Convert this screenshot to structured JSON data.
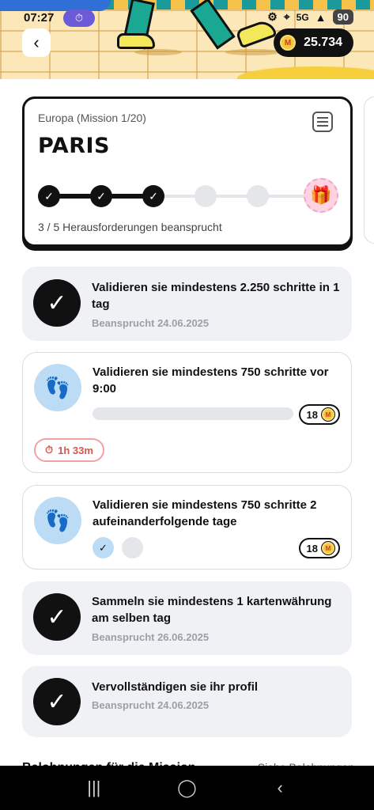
{
  "status_bar": {
    "time": "07:27",
    "pill_icon": "stopwatch",
    "battery": "90",
    "network": "5G"
  },
  "header": {
    "coins": "25.734"
  },
  "mission": {
    "region": "Europa (Mission 1/20)",
    "city": "PARIS",
    "completed_steps": 3,
    "total_steps": 5,
    "progress_text": "3 / 5 Herausforderungen beansprucht",
    "reward_icon": "gift-icon"
  },
  "tasks": [
    {
      "title": "Validieren sie mindestens 2.250 schritte in 1 tag",
      "status": "Beansprucht 24.06.2025",
      "state": "claimed"
    },
    {
      "title": "Validieren sie mindestens 750 schritte vor 9:00",
      "reward": "18",
      "timer": "1h 33m",
      "progress": 0.0,
      "state": "open"
    },
    {
      "title": "Validieren sie mindestens 750 schritte 2 aufeinanderfolgende tage",
      "reward": "18",
      "days_done": 1,
      "days_total": 2,
      "state": "open"
    },
    {
      "title": "Sammeln sie mindestens 1 kartenwährung am selben tag",
      "status": "Beansprucht 26.06.2025",
      "state": "claimed"
    },
    {
      "title": "Vervollständigen sie ihr profil",
      "status": "Beansprucht 24.06.2025",
      "state": "claimed"
    }
  ],
  "section_peek": {
    "title": "Belohnungen für die Mission",
    "link": "Siehe Belohnungen"
  },
  "colors": {
    "dark": "#111111",
    "claimed_bg": "#eff1f4",
    "feet_bg": "#bcdcf6",
    "timer_red": "#d9534f",
    "coin_gold": "#f1c83a"
  }
}
